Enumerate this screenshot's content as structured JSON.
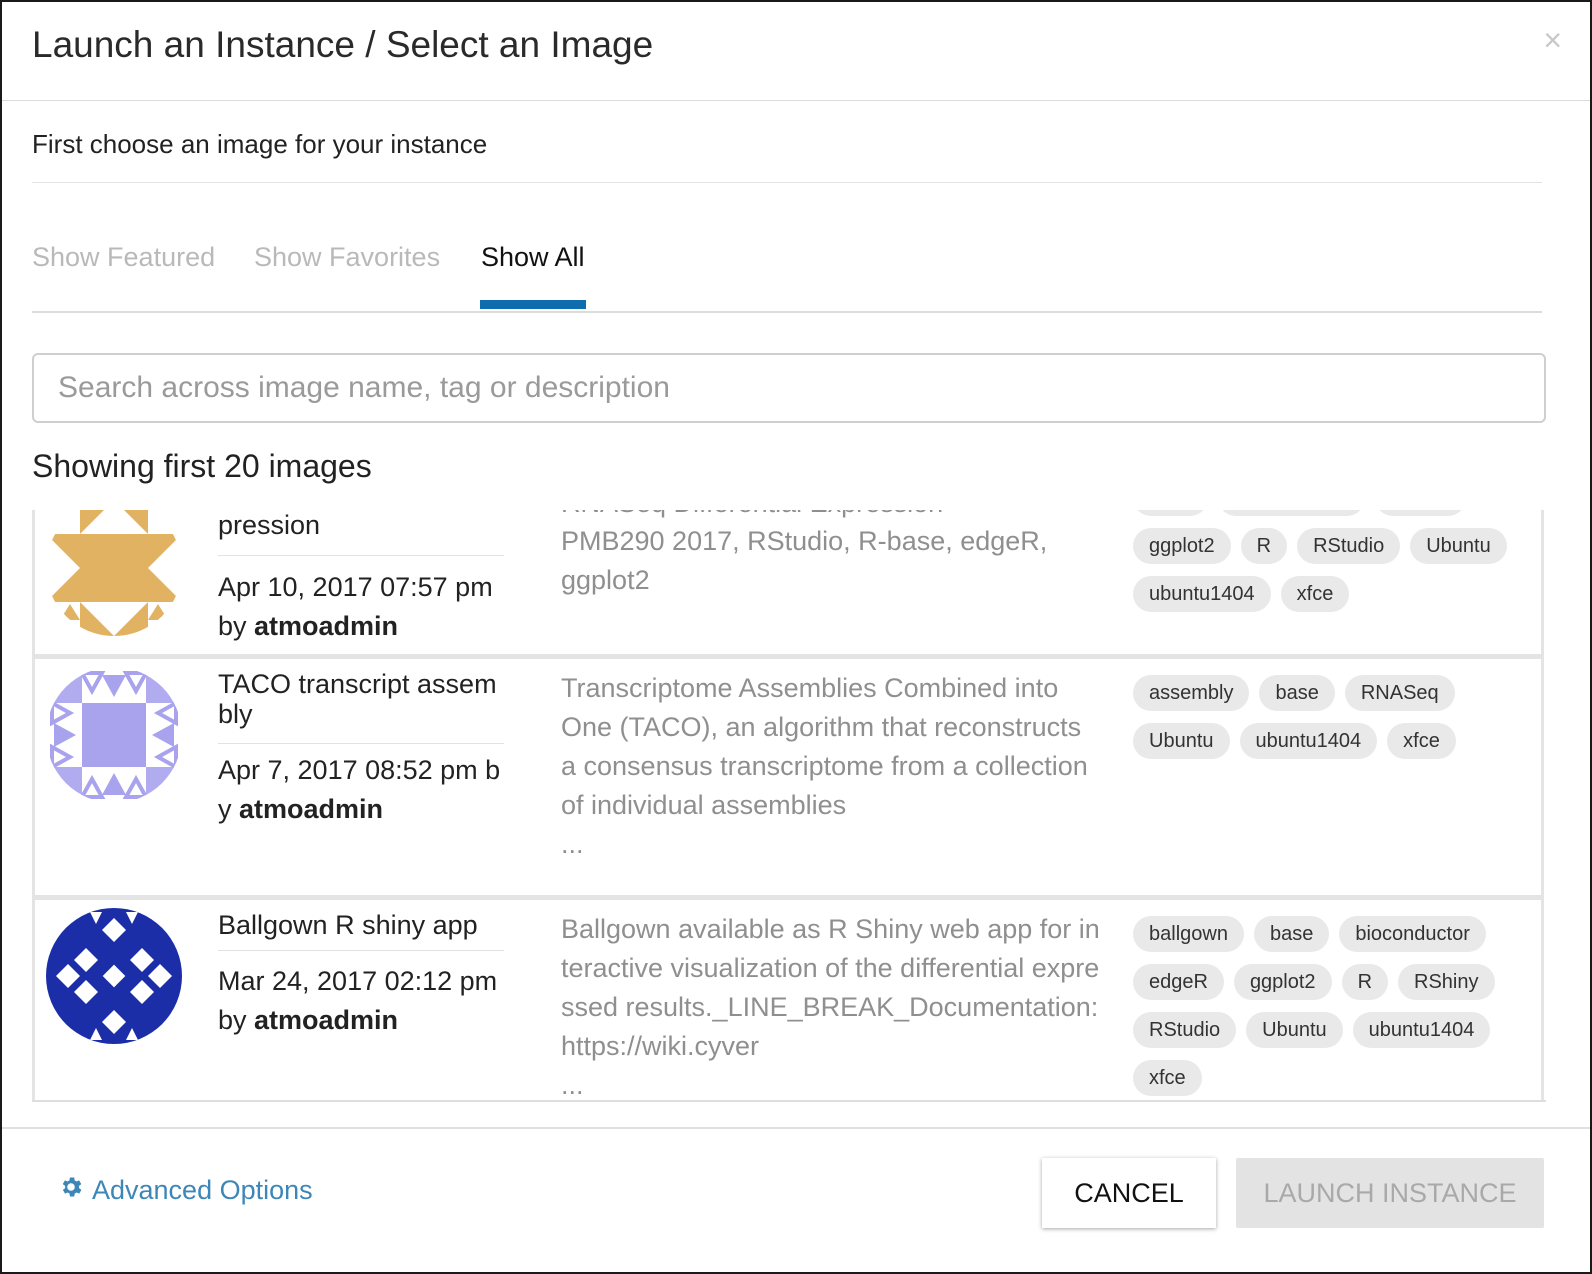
{
  "dialog": {
    "title": "Launch an Instance / Select an Image",
    "close_label": "×",
    "subtitle": "First choose an image for your instance"
  },
  "tabs": [
    {
      "label": "Show Featured",
      "active": false
    },
    {
      "label": "Show Favorites",
      "active": false
    },
    {
      "label": "Show All",
      "active": true
    }
  ],
  "search": {
    "placeholder": "Search across image name, tag or description",
    "value": ""
  },
  "results_label": "Showing first 20 images",
  "images": [
    {
      "name_partial": "pression",
      "date": "Apr 10, 2017 07:57 pm",
      "by_prefix": "by ",
      "author": "atmoadmin",
      "description_partial_top": "RNASeq Differential Expression",
      "description": "PMB290 2017, RStudio, R-base, edgeR, ggplot2",
      "tags_partial_top": [
        "base",
        "bioconductor",
        "edgeR"
      ],
      "tags": [
        "ggplot2",
        "R",
        "RStudio",
        "Ubuntu",
        "ubuntu1404",
        "xfce"
      ],
      "avatar_color": "#e2b263"
    },
    {
      "name": "TACO transcript assembly",
      "date": "Apr 7, 2017 08:52 pm b",
      "by_prefix": "y ",
      "author": "atmoadmin",
      "description": "Transcriptome Assemblies Combined into One (TACO), an algorithm that reconstructs a consensus transcriptome from a collection of individual assemblies",
      "ellipsis": "...",
      "tags": [
        "assembly",
        "base",
        "RNASeq",
        "Ubuntu",
        "ubuntu1404",
        "xfce"
      ],
      "avatar_color": "#a9a3ee"
    },
    {
      "name": "Ballgown R shiny app",
      "date": "Mar 24, 2017 02:12 pm",
      "by_prefix": "by ",
      "author": "atmoadmin",
      "description": "Ballgown available as R Shiny web app for interactive visualization of the differential expressed results._LINE_BREAK_Documentation:https://wiki.cyver",
      "ellipsis": "...",
      "tags": [
        "ballgown",
        "base",
        "bioconductor",
        "edgeR",
        "ggplot2",
        "R",
        "RShiny",
        "RStudio",
        "Ubuntu",
        "ubuntu1404",
        "xfce"
      ],
      "avatar_color": "#1b2ea8"
    }
  ],
  "footer": {
    "advanced_label": "Advanced Options",
    "cancel_label": "CANCEL",
    "launch_label": "LAUNCH INSTANCE"
  },
  "colors": {
    "accent": "#0f6cad",
    "link": "#3d87b8",
    "tag_bg": "#e9e9e9"
  }
}
